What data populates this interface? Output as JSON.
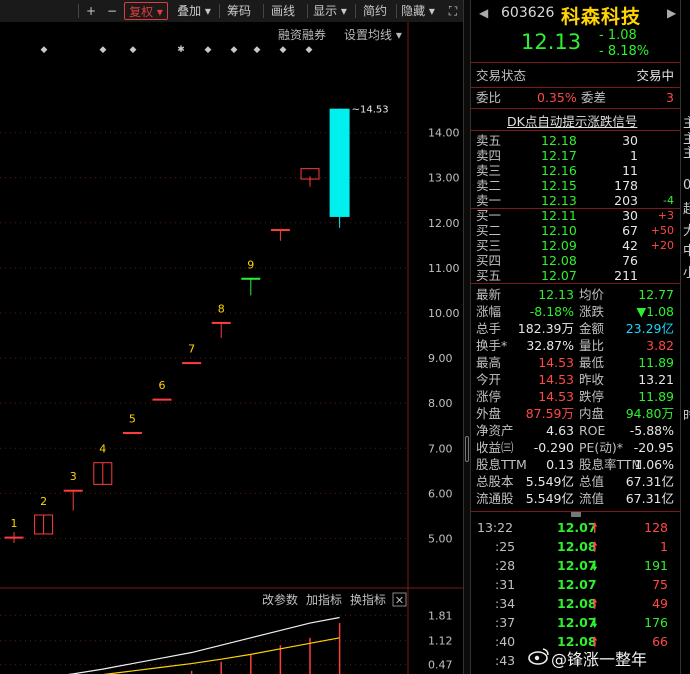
{
  "toolbar": {
    "plus": "+",
    "minus": "−",
    "fuquan": "复权 ▾",
    "diejia": "叠加 ▾",
    "chouma": "筹码",
    "huaxian": "画线",
    "xianshi": "显示 ▾",
    "jianyue": "简约",
    "yincang": "隐藏 ▾",
    "expand": "⛶"
  },
  "chart_header": {
    "margin_link": "融资融券",
    "ma_setting": "设置均线 ▾"
  },
  "chart_data": {
    "type": "candlestick",
    "price_axis_ticks": [
      "14.00",
      "13.00",
      "12.00",
      "11.00",
      "10.00",
      "9.00",
      "8.00",
      "7.00",
      "6.00",
      "5.00"
    ],
    "price_range": [
      4.7,
      14.9
    ],
    "candles": [
      {
        "o": 5.03,
        "h": 5.14,
        "l": 4.9,
        "c": 5.03,
        "color": "red",
        "label": "1"
      },
      {
        "o": 5.1,
        "h": 5.52,
        "l": 5.1,
        "c": 5.52,
        "color": "red",
        "label": "2"
      },
      {
        "o": 6.07,
        "h": 6.07,
        "l": 5.62,
        "c": 6.07,
        "color": "red",
        "label": "3"
      },
      {
        "o": 6.2,
        "h": 6.68,
        "l": 6.2,
        "c": 6.68,
        "color": "red",
        "label": "4"
      },
      {
        "o": 7.35,
        "h": 7.35,
        "l": 7.35,
        "c": 7.35,
        "color": "red",
        "label": "5"
      },
      {
        "o": 8.09,
        "h": 8.09,
        "l": 8.09,
        "c": 8.09,
        "color": "red",
        "label": "6"
      },
      {
        "o": 8.9,
        "h": 8.9,
        "l": 8.9,
        "c": 8.9,
        "color": "red",
        "label": "7"
      },
      {
        "o": 9.79,
        "h": 9.79,
        "l": 9.45,
        "c": 9.79,
        "color": "red",
        "label": "8"
      },
      {
        "o": 10.77,
        "h": 10.77,
        "l": 10.39,
        "c": 10.77,
        "color": "green",
        "label": "9"
      },
      {
        "o": 11.85,
        "h": 11.85,
        "l": 11.6,
        "c": 11.85,
        "color": "red",
        "label": ""
      },
      {
        "o": 12.97,
        "h": 13.03,
        "l": 12.8,
        "c": 13.2,
        "color": "red",
        "label": ""
      },
      {
        "o": 14.53,
        "h": 14.53,
        "l": 11.89,
        "c": 12.13,
        "color": "cyan",
        "label": ""
      }
    ],
    "high_marker": "~14.53",
    "event_markers": [
      "◆",
      "◆",
      "◆",
      "✱",
      "◆",
      "◆",
      "◆",
      "◆",
      "◆",
      "◆"
    ],
    "indicator": {
      "links": [
        "改参数",
        "加指标",
        "换指标"
      ],
      "close": "✕",
      "axis_ticks": [
        "1.81",
        "1.12",
        "0.47"
      ],
      "bars": [
        0.0,
        0.0,
        0.0,
        0.0,
        0.0,
        0.0,
        0.3,
        0.55,
        0.75,
        1.0,
        1.2,
        1.6
      ],
      "white_line": [
        0.05,
        0.12,
        0.22,
        0.35,
        0.5,
        0.65,
        0.8,
        1.0,
        1.2,
        1.4,
        1.6,
        1.75
      ],
      "yellow_line": [
        0.02,
        0.06,
        0.12,
        0.2,
        0.3,
        0.4,
        0.5,
        0.62,
        0.75,
        0.9,
        1.05,
        1.2
      ]
    }
  },
  "stock": {
    "code": "603626",
    "name": "科森科技",
    "price": "12.13",
    "change": "- 1.08",
    "change_pct": "- 8.18%"
  },
  "status": {
    "label": "交易状态",
    "value": "交易中"
  },
  "weibi": {
    "label": "委比",
    "value": "0.35%",
    "diff_label": "委差",
    "diff_value": "3"
  },
  "signal": "DK点自动提示涨跌信号",
  "sell_orders": [
    {
      "label": "卖五",
      "price": "12.18",
      "vol": "30",
      "delta": ""
    },
    {
      "label": "卖四",
      "price": "12.17",
      "vol": "1",
      "delta": ""
    },
    {
      "label": "卖三",
      "price": "12.16",
      "vol": "11",
      "delta": ""
    },
    {
      "label": "卖二",
      "price": "12.15",
      "vol": "178",
      "delta": ""
    },
    {
      "label": "卖一",
      "price": "12.13",
      "vol": "203",
      "delta": "-4"
    }
  ],
  "buy_orders": [
    {
      "label": "买一",
      "price": "12.11",
      "vol": "30",
      "delta": "+3"
    },
    {
      "label": "买二",
      "price": "12.10",
      "vol": "67",
      "delta": "+50"
    },
    {
      "label": "买三",
      "price": "12.09",
      "vol": "42",
      "delta": "+20"
    },
    {
      "label": "买四",
      "price": "12.08",
      "vol": "76",
      "delta": ""
    },
    {
      "label": "买五",
      "price": "12.07",
      "vol": "211",
      "delta": ""
    }
  ],
  "stats": [
    {
      "l1": "最新",
      "v1": "12.13",
      "c1": "green",
      "l2": "均价",
      "v2": "12.77",
      "c2": "green"
    },
    {
      "l1": "涨幅",
      "v1": "-8.18%",
      "c1": "green",
      "l2": "涨跌",
      "v2": "▼1.08",
      "c2": "green"
    },
    {
      "l1": "总手",
      "v1": "182.39万",
      "c1": "white",
      "l2": "金额",
      "v2": "23.29亿",
      "c2": "cyan"
    },
    {
      "l1": "换手*",
      "v1": "32.87%",
      "c1": "white",
      "l2": "量比",
      "v2": "3.82",
      "c2": "red"
    },
    {
      "l1": "最高",
      "v1": "14.53",
      "c1": "red",
      "l2": "最低",
      "v2": "11.89",
      "c2": "green"
    },
    {
      "l1": "今开",
      "v1": "14.53",
      "c1": "red",
      "l2": "昨收",
      "v2": "13.21",
      "c2": "white"
    },
    {
      "l1": "涨停",
      "v1": "14.53",
      "c1": "red",
      "l2": "跌停",
      "v2": "11.89",
      "c2": "green"
    },
    {
      "l1": "外盘",
      "v1": "87.59万",
      "c1": "red",
      "l2": "内盘",
      "v2": "94.80万",
      "c2": "green"
    },
    {
      "l1": "净资产",
      "v1": "4.63",
      "c1": "white",
      "l2": "ROE",
      "v2": "-5.88%",
      "c2": "white"
    },
    {
      "l1": "收益㈢",
      "v1": "-0.290",
      "c1": "white",
      "l2": "PE(动)*",
      "v2": "-20.95",
      "c2": "white"
    },
    {
      "l1": "股息TTM",
      "v1": "0.13",
      "c1": "white",
      "l2": "股息率TTM",
      "v2": "1.06%",
      "c2": "white"
    },
    {
      "l1": "总股本",
      "v1": "5.549亿",
      "c1": "white",
      "l2": "总值",
      "v2": "67.31亿",
      "c2": "white"
    },
    {
      "l1": "流通股",
      "v1": "5.549亿",
      "c1": "white",
      "l2": "流值",
      "v2": "67.31亿",
      "c2": "white"
    }
  ],
  "ticks": [
    {
      "time": "13:22",
      "price": "12.07",
      "dir": "up",
      "vol": "128",
      "vc": "red"
    },
    {
      "time": ":25",
      "price": "12.08",
      "dir": "up",
      "vol": "1",
      "vc": "red"
    },
    {
      "time": ":28",
      "price": "12.07",
      "dir": "down",
      "vol": "191",
      "vc": "green"
    },
    {
      "time": ":31",
      "price": "12.07",
      "dir": "",
      "vol": "75",
      "vc": "red"
    },
    {
      "time": ":34",
      "price": "12.08",
      "dir": "up",
      "vol": "49",
      "vc": "red"
    },
    {
      "time": ":37",
      "price": "12.07",
      "dir": "down",
      "vol": "176",
      "vc": "green"
    },
    {
      "time": ":40",
      "price": "12.08",
      "dir": "up",
      "vol": "66",
      "vc": "red"
    },
    {
      "time": ":43",
      "price": "",
      "dir": "",
      "vol": "",
      "vc": "red"
    }
  ],
  "edge_glyphs": [
    "主",
    "主",
    "主",
    "0",
    "超",
    "大",
    "中",
    "小",
    "",
    "",
    "",
    "",
    "时"
  ],
  "watermark": "@锋涨一整年"
}
